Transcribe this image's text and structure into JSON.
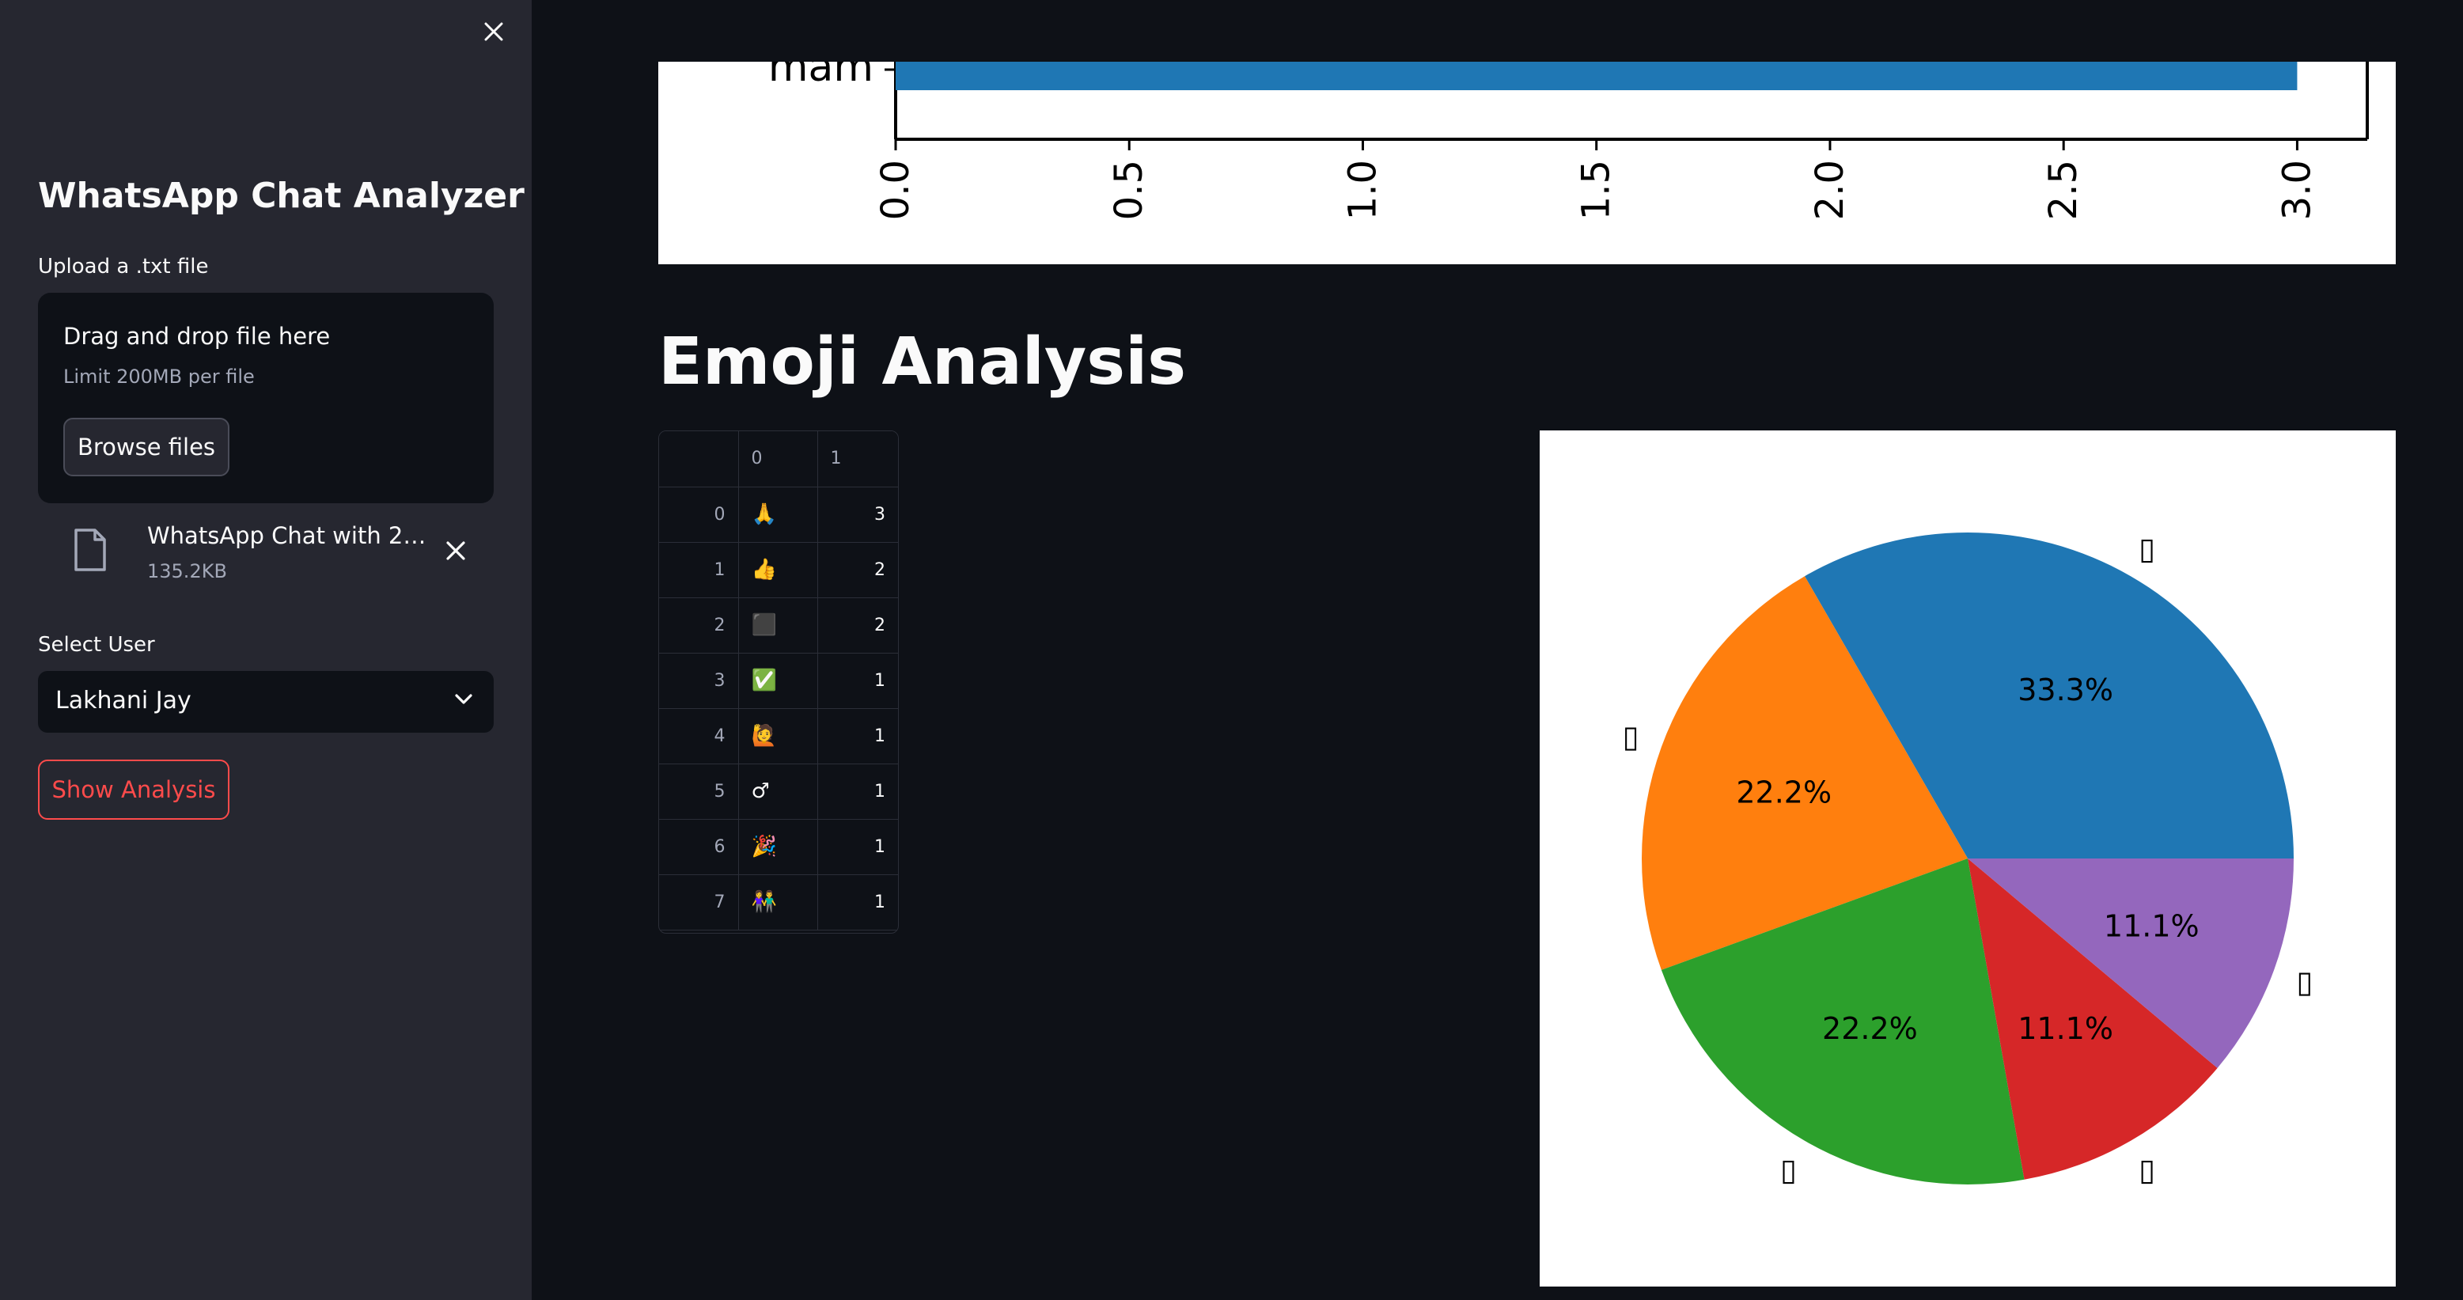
{
  "sidebar": {
    "title": "WhatsApp Chat Analyzer",
    "upload_label": "Upload a .txt file",
    "dropzone_title": "Drag and drop file here",
    "dropzone_limit": "Limit 200MB per file",
    "browse_label": "Browse files",
    "file_name": "WhatsApp Chat with 20C...",
    "file_size": "135.2KB",
    "select_label": "Select User",
    "select_value": "Lakhani Jay",
    "show_analysis_label": "Show Analysis"
  },
  "main": {
    "emoji_heading": "Emoji Analysis",
    "table": {
      "columns": [
        "0",
        "1"
      ],
      "rows": [
        {
          "index": "0",
          "emoji": "🙏",
          "count": "3"
        },
        {
          "index": "1",
          "emoji": "👍",
          "count": "2"
        },
        {
          "index": "2",
          "emoji": "⬛",
          "count": "2"
        },
        {
          "index": "3",
          "emoji": "✅",
          "count": "1"
        },
        {
          "index": "4",
          "emoji": "🙋",
          "count": "1"
        },
        {
          "index": "5",
          "emoji": "♂",
          "count": "1"
        },
        {
          "index": "6",
          "emoji": "🎉",
          "count": "1"
        },
        {
          "index": "7",
          "emoji": "👫",
          "count": "1"
        }
      ]
    }
  },
  "colors": {
    "accent": "#ff4b4b",
    "sidebar_bg": "#262730",
    "main_bg": "#0e1117",
    "series_blue": "#1f77b4"
  },
  "chart_data": [
    {
      "type": "bar",
      "orientation": "horizontal",
      "categories": [
        "mam"
      ],
      "values": [
        3
      ],
      "xticks": [
        "0.0",
        "0.5",
        "1.0",
        "1.5",
        "2.0",
        "2.5",
        "3.0"
      ],
      "xlim": [
        0,
        3.15
      ],
      "color": "#1f77b4"
    },
    {
      "type": "pie",
      "labels": [
        "▯",
        "▯",
        "▯",
        "▯",
        "▯"
      ],
      "values": [
        33.3,
        22.2,
        22.2,
        11.1,
        11.1
      ],
      "pct_labels": [
        "33.3%",
        "22.2%",
        "22.2%",
        "11.1%",
        "11.1%"
      ],
      "colors": [
        "#1f77b4",
        "#ff7f0e",
        "#2ca02c",
        "#d62728",
        "#9467bd"
      ]
    }
  ]
}
